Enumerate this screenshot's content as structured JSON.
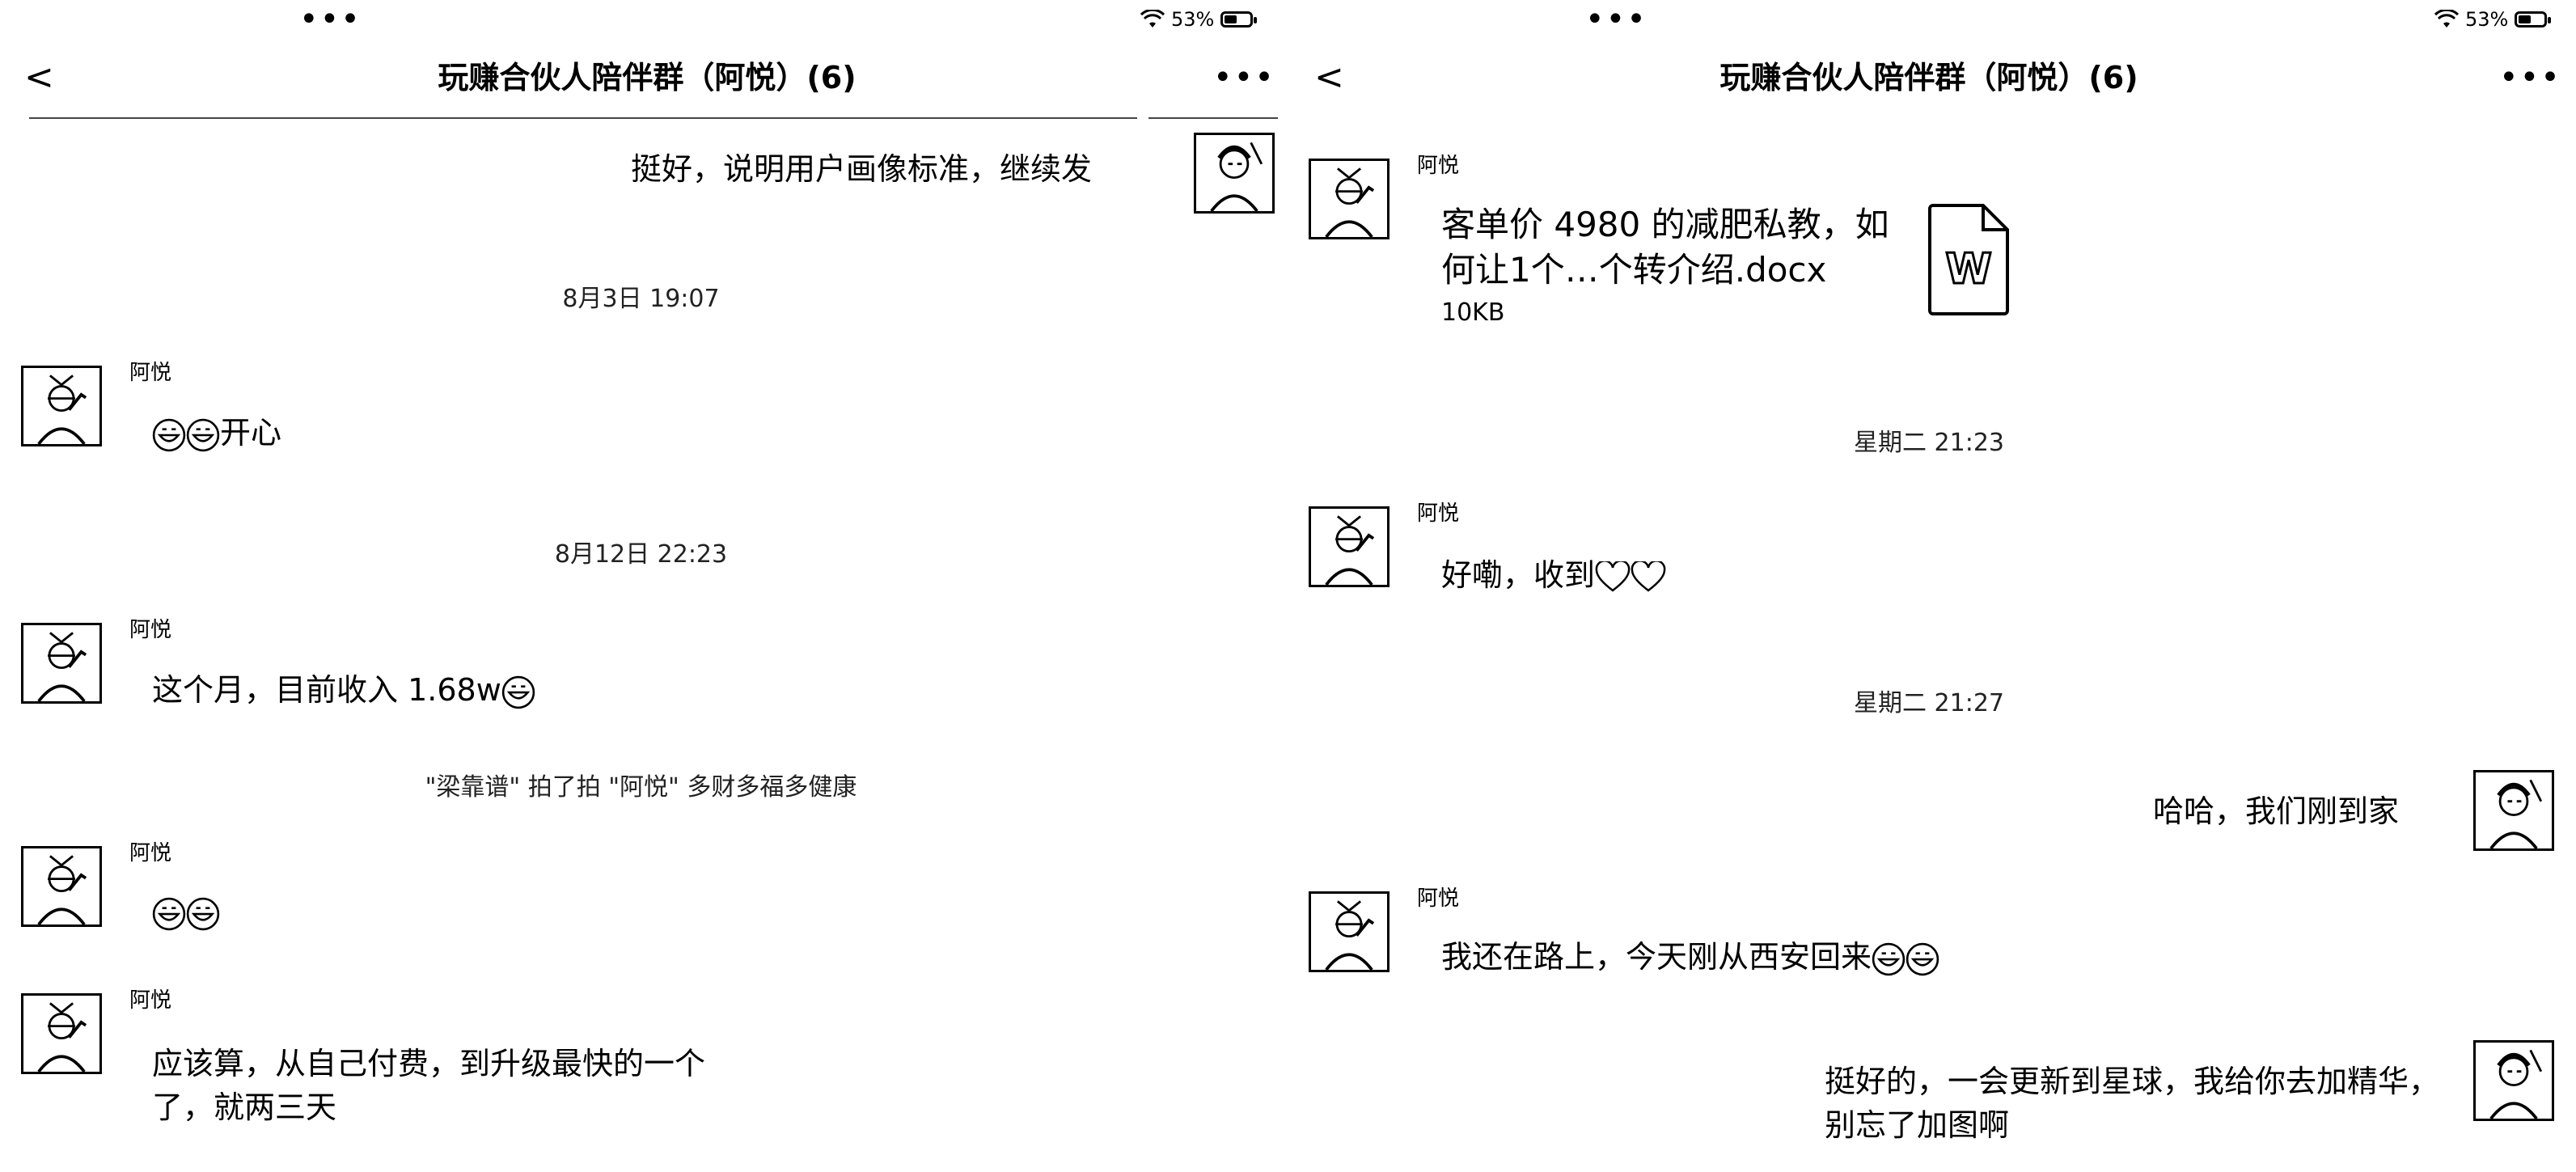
{
  "left": {
    "status": {
      "dots": "•••",
      "battery": "53%"
    },
    "header": {
      "title": "玩赚合伙人陪伴群（阿悦）(6)",
      "back": "<",
      "more": "•••"
    },
    "messages": {
      "m1": "挺好，说明用户画像标准，继续发",
      "ts1": "8月3日 19:07",
      "sender": "阿悦",
      "m2": "开心",
      "ts2": "8月12日 22:23",
      "m3": "这个月，目前收入 1.68w",
      "pat": "\"梁靠谱\" 拍了拍 \"阿悦\" 多财多福多健康",
      "m5": "应该算，从自己付费，到升级最快的一个了，就两三天"
    }
  },
  "right": {
    "status": {
      "dots": "•••",
      "battery": "53%"
    },
    "header": {
      "title": "玩赚合伙人陪伴群（阿悦）(6)",
      "back": "<",
      "more": "•••"
    },
    "messages": {
      "sender": "阿悦",
      "file_name": "客单价 4980 的减肥私教，如何让1个…个转介绍.docx",
      "file_size": "10KB",
      "file_icon_letter": "W",
      "ts1": "星期二 21:23",
      "m2": "好嘞，收到",
      "ts2": "星期二 21:27",
      "m3": "哈哈，我们刚到家",
      "m4": "我还在路上，今天刚从西安回来",
      "m5": "挺好的，一会更新到星球，我给你去加精华，别忘了加图啊"
    }
  },
  "icons": {
    "back": "chevron-left-icon",
    "more": "more-dots-icon",
    "wifi": "wifi-icon",
    "battery": "battery-icon",
    "emoji": "grinning-face-icon",
    "heart": "heart-outline-icon",
    "file": "word-document-icon"
  }
}
